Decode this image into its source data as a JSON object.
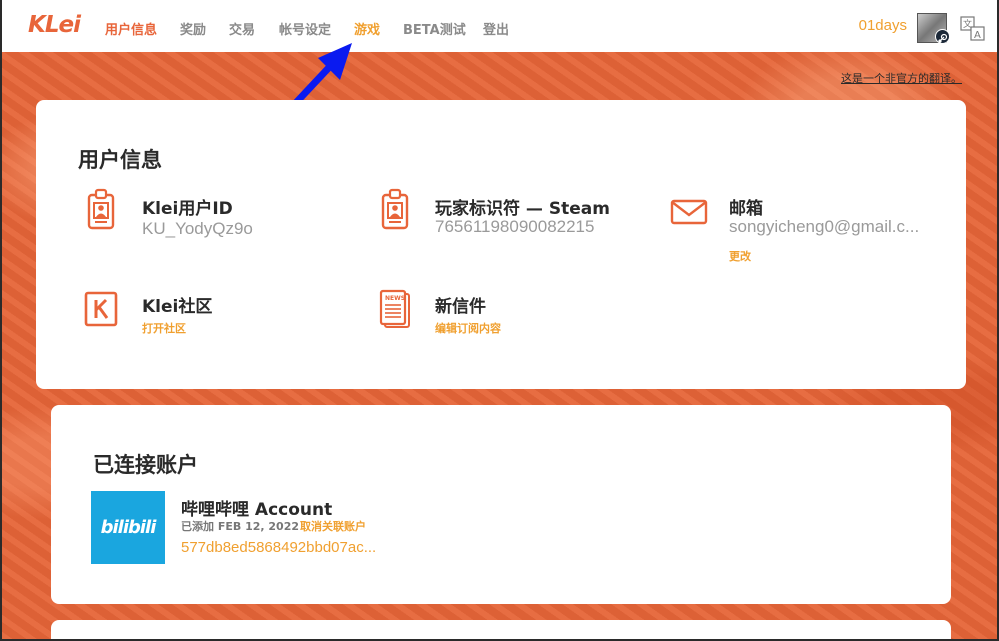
{
  "nav": {
    "logo": "KLei",
    "items": [
      {
        "label": "用户信息",
        "state": "active"
      },
      {
        "label": "奖励"
      },
      {
        "label": "交易"
      },
      {
        "label": "帐号设定"
      },
      {
        "label": "游戏",
        "state": "highlighted"
      },
      {
        "label": "BETA测试"
      },
      {
        "label": "登出"
      }
    ],
    "days": "01days",
    "avatar_icon": "user-avatar-icon",
    "steam_icon": "steam-icon",
    "translate_icon": "translate-icon"
  },
  "disclaimer": "这是一个非官方的翻译。",
  "user_info": {
    "title": "用户信息",
    "klei_id": {
      "title": "Klei用户ID",
      "value": "KU_YodyQz9o",
      "icon": "id-badge-icon"
    },
    "player_id": {
      "title": "玩家标识符 — Steam",
      "value": "76561198090082215",
      "icon": "id-badge-icon"
    },
    "email": {
      "title": "邮箱",
      "value": "songyicheng0@gmail.c...",
      "link": "更改",
      "icon": "mail-icon"
    },
    "community": {
      "title": "Klei社区",
      "link": "打开社区",
      "icon": "klei-k-icon"
    },
    "newsletter": {
      "title": "新信件",
      "link": "编辑订阅内容",
      "icon": "news-icon"
    }
  },
  "connected": {
    "title": "已连接账户",
    "account": {
      "name": "哔哩哔哩 Account",
      "logo_text": "bilibili",
      "added": "已添加 FEB 12, 2022",
      "unlink": "取消关联账户",
      "id": "577db8ed5868492bbd07ac..."
    }
  },
  "colors": {
    "accent": "#e8653a",
    "link": "#f0a030",
    "bilibili": "#1aa6df",
    "arrow": "#0a1af0"
  }
}
